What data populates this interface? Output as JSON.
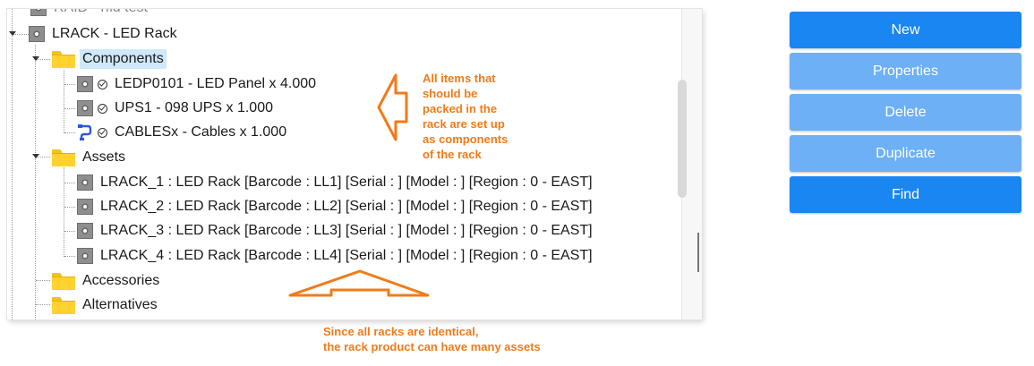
{
  "tree": {
    "top_cut_label": "RAID - rfid test",
    "root": {
      "label": "LRACK - LED Rack"
    },
    "components": {
      "label": "Components",
      "items": [
        {
          "label": "LEDP0101 - LED Panel x 4.000"
        },
        {
          "label": "UPS1 - 098 UPS x 1.000"
        },
        {
          "label": "CABLESx - Cables x 1.000"
        }
      ]
    },
    "assets": {
      "label": "Assets",
      "items": [
        {
          "label": "LRACK_1 : LED Rack [Barcode : LL1] [Serial : ] [Model : ] [Region : 0 - EAST]"
        },
        {
          "label": "LRACK_2 : LED Rack [Barcode : LL2] [Serial : ] [Model : ] [Region : 0 - EAST]"
        },
        {
          "label": "LRACK_3 : LED Rack [Barcode : LL3] [Serial : ] [Model : ] [Region : 0 - EAST]"
        },
        {
          "label": "LRACK_4 : LED Rack [Barcode : LL4] [Serial : ] [Model : ] [Region : 0 - EAST]"
        }
      ]
    },
    "accessories": {
      "label": "Accessories"
    },
    "alternatives": {
      "label": "Alternatives"
    }
  },
  "buttons": {
    "new": "New",
    "properties": "Properties",
    "delete": "Delete",
    "duplicate": "Duplicate",
    "find": "Find"
  },
  "annotations": {
    "components_note": [
      "All items that",
      "should be",
      "packed in the",
      "rack are set up",
      "as components",
      "of the rack"
    ],
    "assets_note": [
      "Since all racks are identical,",
      "the rack product can have many assets"
    ]
  },
  "colors": {
    "button_active": "#1a86f2",
    "button_dim": "#6db0f6",
    "annotation": "#f07b1a",
    "selection": "#cfe8fa"
  }
}
